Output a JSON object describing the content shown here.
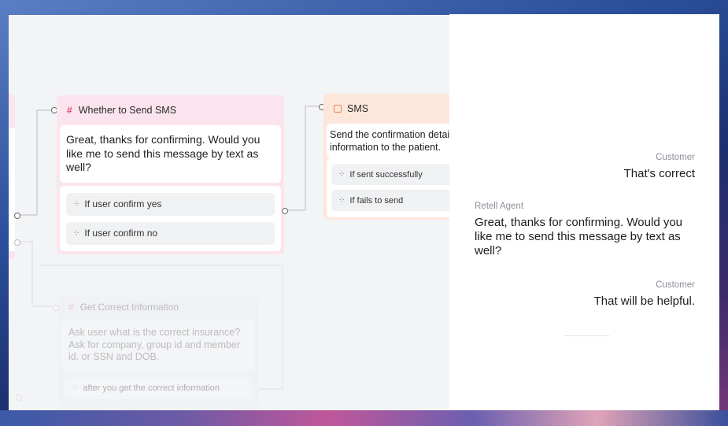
{
  "flow": {
    "node_send_sms": {
      "title": "Whether to Send SMS",
      "body": "Great, thanks for confirming. Would you like me to send this message by text as well?",
      "edges": [
        "If user confirm yes",
        "If user confirm no"
      ]
    },
    "node_sms": {
      "title": "SMS",
      "body": "Send the confirmation details information to the patient.",
      "edges": [
        "If sent successfully",
        "If fails to send"
      ]
    },
    "node_correct_info": {
      "title": "Get Correct Information",
      "body": "Ask user what is the correct insurance? Ask for company, group id and member id. or SSN and DOB.",
      "edges": [
        "after you get the correct information"
      ]
    }
  },
  "transcript": {
    "messages": [
      {
        "speaker": "Customer",
        "text": "That's correct"
      },
      {
        "speaker": "Retell Agent",
        "text": "Great, thanks for confirming. Would you like me to send this message by text as well?"
      },
      {
        "speaker": "Customer",
        "text": "That will be helpful."
      }
    ]
  },
  "colors": {
    "node_pink": "#fbe4ee",
    "node_peach": "#fde7db",
    "hash_accent": "#e04a7a",
    "sms_accent": "#e8855a"
  }
}
